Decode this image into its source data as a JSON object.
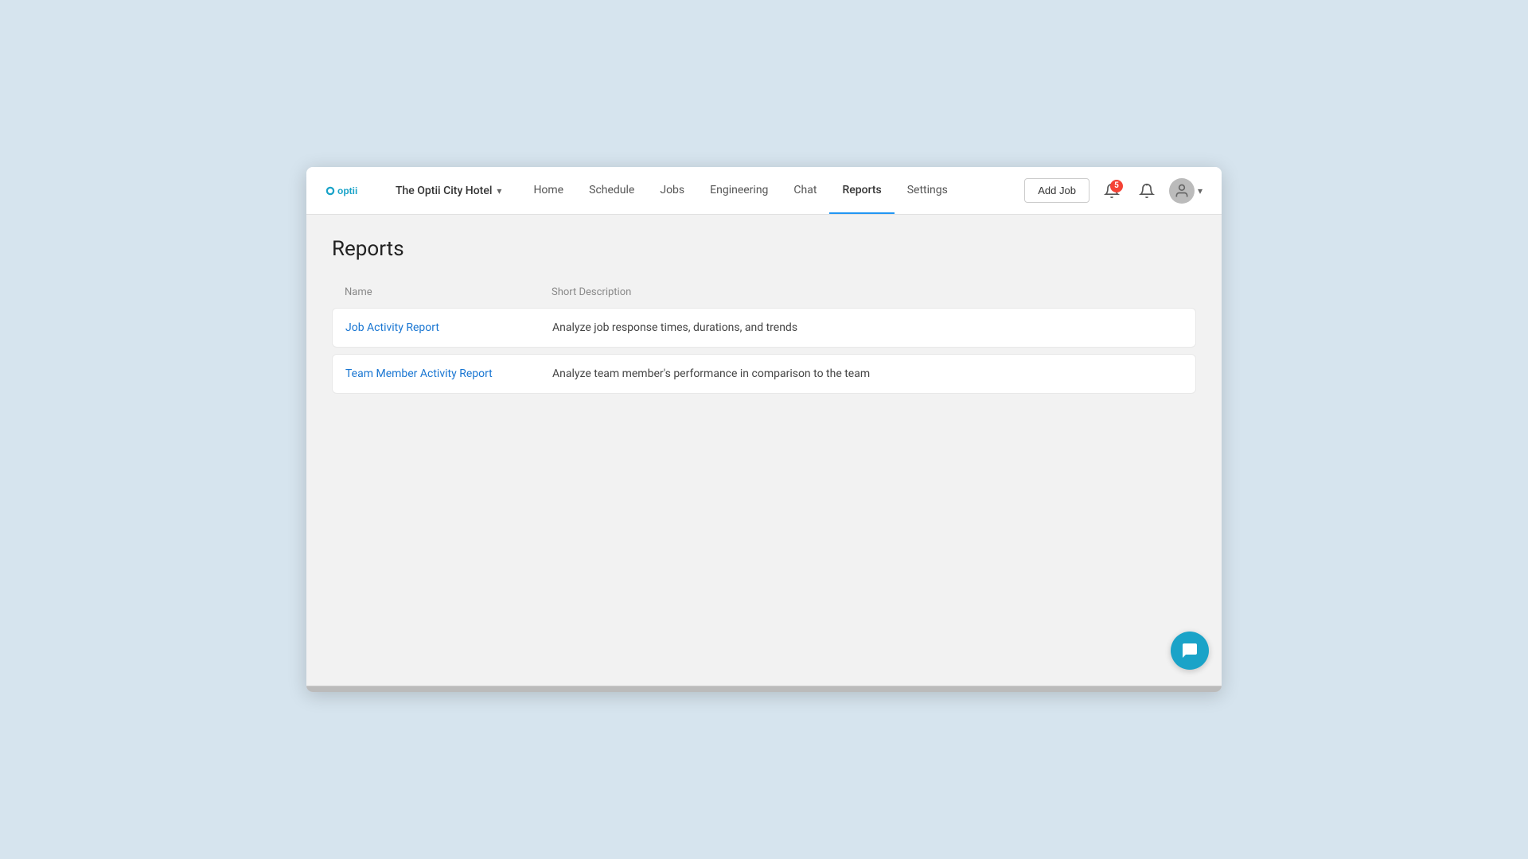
{
  "app": {
    "logo_text": "optii",
    "hotel_name": "The Optii City Hotel"
  },
  "nav": {
    "items": [
      {
        "label": "Home",
        "active": false
      },
      {
        "label": "Schedule",
        "active": false
      },
      {
        "label": "Jobs",
        "active": false
      },
      {
        "label": "Engineering",
        "active": false
      },
      {
        "label": "Chat",
        "active": false
      },
      {
        "label": "Reports",
        "active": true
      },
      {
        "label": "Settings",
        "active": false
      }
    ]
  },
  "header": {
    "add_job_label": "Add Job",
    "notification_count": "5"
  },
  "page": {
    "title": "Reports",
    "table": {
      "columns": [
        {
          "label": "Name"
        },
        {
          "label": "Short Description"
        }
      ],
      "rows": [
        {
          "name": "Job Activity Report",
          "description": "Analyze job response times, durations, and trends"
        },
        {
          "name": "Team Member Activity Report",
          "description": "Analyze team member's performance in comparison to the team"
        }
      ]
    }
  }
}
